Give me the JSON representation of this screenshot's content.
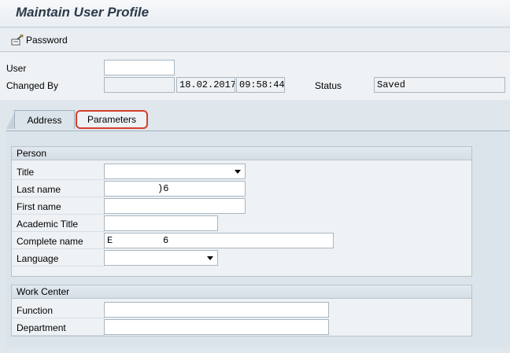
{
  "window": {
    "title": "Maintain User Profile"
  },
  "toolbar": {
    "password_label": "Password"
  },
  "header": {
    "user_label": "User",
    "user_value": "",
    "changed_by_label": "Changed By",
    "changed_by_value": "",
    "date_value": "18.02.2017",
    "time_value": "09:58:44",
    "status_label": "Status",
    "status_value": "Saved"
  },
  "tabs": [
    {
      "label": "Address"
    },
    {
      "label": "Parameters"
    }
  ],
  "person": {
    "title": "Person",
    "title_label": "Title",
    "title_value": "",
    "last_name_label": "Last name",
    "last_name_value": ")6",
    "first_name_label": "First name",
    "first_name_value": "",
    "academic_title_label": "Academic Title",
    "academic_title_value": "",
    "complete_name_label": "Complete name",
    "complete_name_prefix": "E",
    "complete_name_value": "6",
    "language_label": "Language",
    "language_value": ""
  },
  "work_center": {
    "title": "Work Center",
    "function_label": "Function",
    "function_value": "",
    "department_label": "Department",
    "department_value": ""
  }
}
